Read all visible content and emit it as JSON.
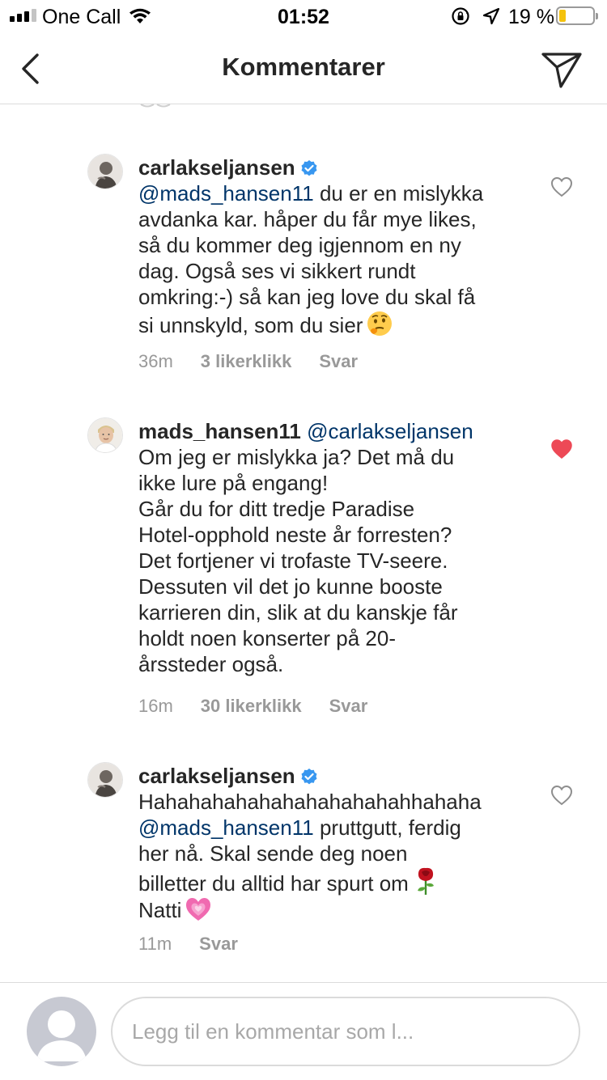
{
  "status_bar": {
    "carrier": "One Call",
    "time": "01:52",
    "battery_percent": "19 %",
    "battery_level": 0.19
  },
  "nav": {
    "title": "Kommentarer",
    "back_icon": "chevron-left-icon",
    "send_icon": "paper-plane-icon"
  },
  "comments": [
    {
      "username": "carlakseljansen",
      "verified": true,
      "mention": "@mads_hansen11",
      "text_lines": [
        " du er en mislykka",
        "avdanka kar. håper du får mye likes,",
        "så du kommer deg igjennom en ny",
        "dag. Også ses vi sikkert rundt",
        "omkring:-) så kan jeg love du skal få",
        "si unnskyld, som du sier"
      ],
      "emoji": "thinking-face-emoji",
      "time": "36m",
      "likes": "3 likerklikk",
      "reply": "Svar",
      "liked": false
    },
    {
      "username": "mads_hansen11",
      "verified": false,
      "mention": "@carlakseljansen",
      "text_lines": [
        "Om jeg er mislykka ja? Det må du",
        "ikke lure på engang!",
        "Går du for ditt tredje Paradise",
        "Hotel-opphold neste år forresten?",
        "Det fortjener vi trofaste TV-seere.",
        "Dessuten vil det jo kunne booste",
        "karrieren din, slik at du kanskje får",
        "holdt noen konserter på 20-",
        "årssteder også."
      ],
      "time": "16m",
      "likes": "30 likerklikk",
      "reply": "Svar",
      "liked": true
    },
    {
      "username": "carlakseljansen",
      "verified": true,
      "mention": "@mads_hansen11",
      "text_lines": [
        "Hahahahahahahahahahahahhahaha",
        " pruttgutt, ferdig",
        "her nå. Skal sende deg noen",
        "billetter du alltid har spurt om",
        "Natti"
      ],
      "emoji_rose": "rose-emoji",
      "emoji_heart": "growing-heart-emoji",
      "time": "11m",
      "reply": "Svar",
      "liked": false
    }
  ],
  "composer": {
    "placeholder": "Legg til en kommentar som l..."
  },
  "colors": {
    "mention": "#003569",
    "liked_heart": "#ed4956",
    "verified": "#3897f0",
    "meta_text": "#999999"
  }
}
